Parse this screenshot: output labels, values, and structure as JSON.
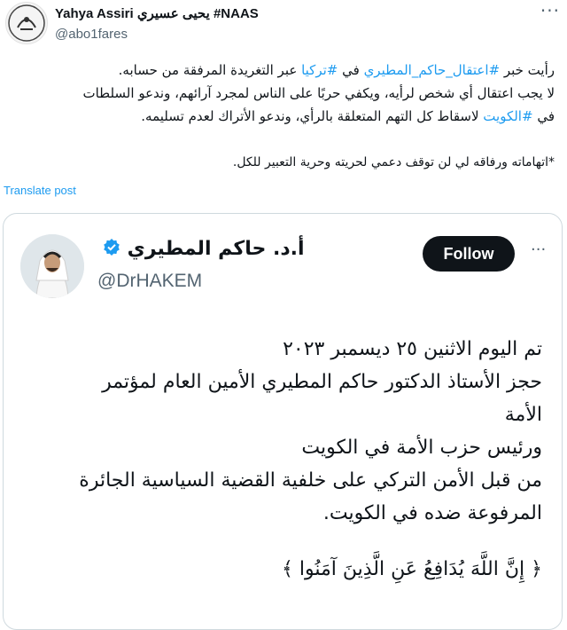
{
  "author": {
    "name": "Yahya Assiri يحيى عسيري #NAAS",
    "handle": "@abo1fares"
  },
  "tweet": {
    "lines": [
      {
        "segments": [
          {
            "text": "رأيت خبر ",
            "tag": false
          },
          {
            "text": "#اعتقال_حاكم_المطيري",
            "tag": true
          },
          {
            "text": " في ",
            "tag": false
          },
          {
            "text": "#تركيا",
            "tag": true
          },
          {
            "text": " عبر التغريدة المرفقة من حسابه.",
            "tag": false
          }
        ]
      },
      {
        "segments": [
          {
            "text": "لا يجب اعتقال أي شخص لرأيه، ويكفي حربًا على الناس لمجرد آرائهم، وندعو السلطات",
            "tag": false
          }
        ]
      },
      {
        "segments": [
          {
            "text": "في ",
            "tag": false
          },
          {
            "text": "#الكويت",
            "tag": true
          },
          {
            "text": " لاسقاط كل التهم المتعلقة بالرأي، وندعو الأتراك لعدم تسليمه.",
            "tag": false
          }
        ]
      }
    ],
    "footnote": "*اتهاماته ورفاقه لي لن توقف دعمي لحريته وحرية التعبير للكل."
  },
  "translate_label": "Translate post",
  "quote": {
    "name": "أ.د. حاكم المطيري",
    "handle": "@DrHAKEM",
    "follow_label": "Follow",
    "body_lines": [
      "تم اليوم الاثنين ٢٥ ديسمبر ٢٠٢٣",
      "حجز الأستاذ الدكتور حاكم المطيري الأمين العام لمؤتمر",
      "الأمة",
      "ورئيس حزب الأمة في الكويت",
      "من قبل الأمن التركي على خلفية القضية السياسية الجائرة",
      "المرفوعة ضده في الكويت."
    ],
    "verse": "﴿ إِنَّ اللَّهَ يُدَافِعُ عَنِ الَّذِينَ آمَنُوا ﴾"
  },
  "colors": {
    "link": "#1d9bf0",
    "text": "#0f1419",
    "secondary": "#536471",
    "border": "#cfd9de",
    "follow_bg": "#0f1419"
  }
}
